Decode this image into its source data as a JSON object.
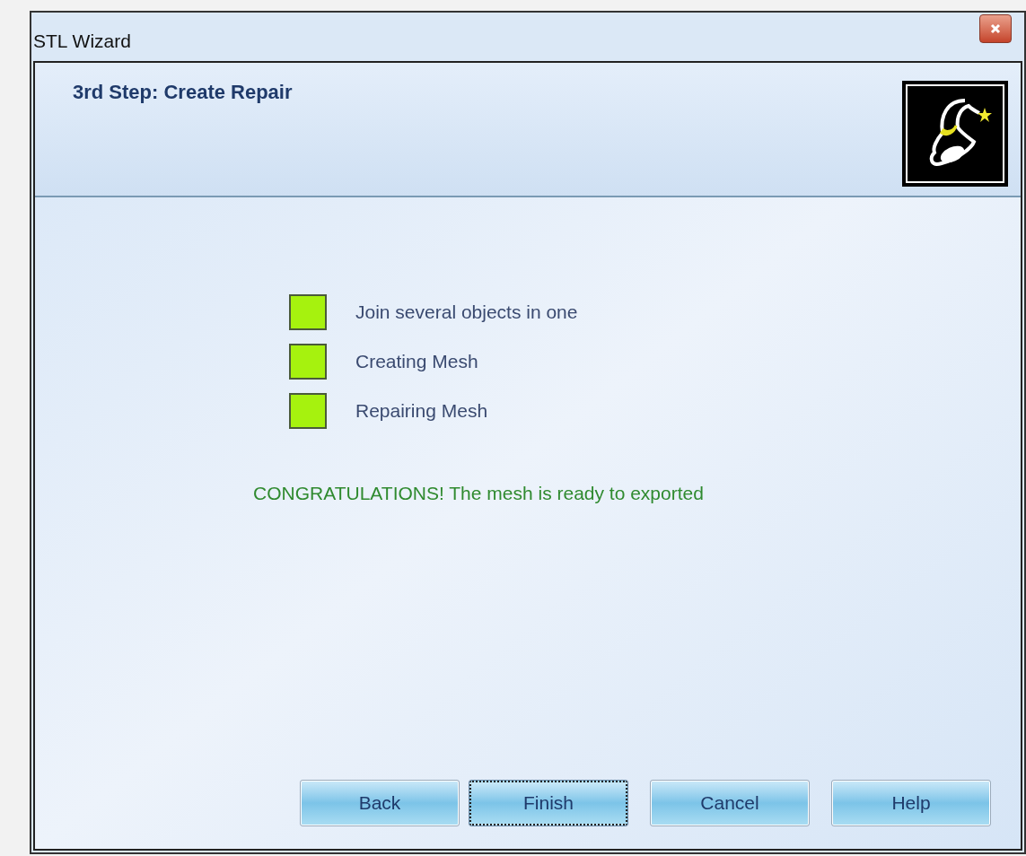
{
  "window": {
    "title": "STL Wizard"
  },
  "header": {
    "title": "3rd Step: Create Repair"
  },
  "steps": [
    {
      "label": "Join several objects in one",
      "done": true
    },
    {
      "label": "Creating Mesh",
      "done": true
    },
    {
      "label": "Repairing Mesh",
      "done": true
    }
  ],
  "message": "CONGRATULATIONS! The mesh is ready to exported",
  "buttons": [
    {
      "label": "Back",
      "focused": false
    },
    {
      "label": "Finish",
      "focused": true
    },
    {
      "label": "Cancel",
      "focused": false
    },
    {
      "label": "Help",
      "focused": false
    }
  ]
}
